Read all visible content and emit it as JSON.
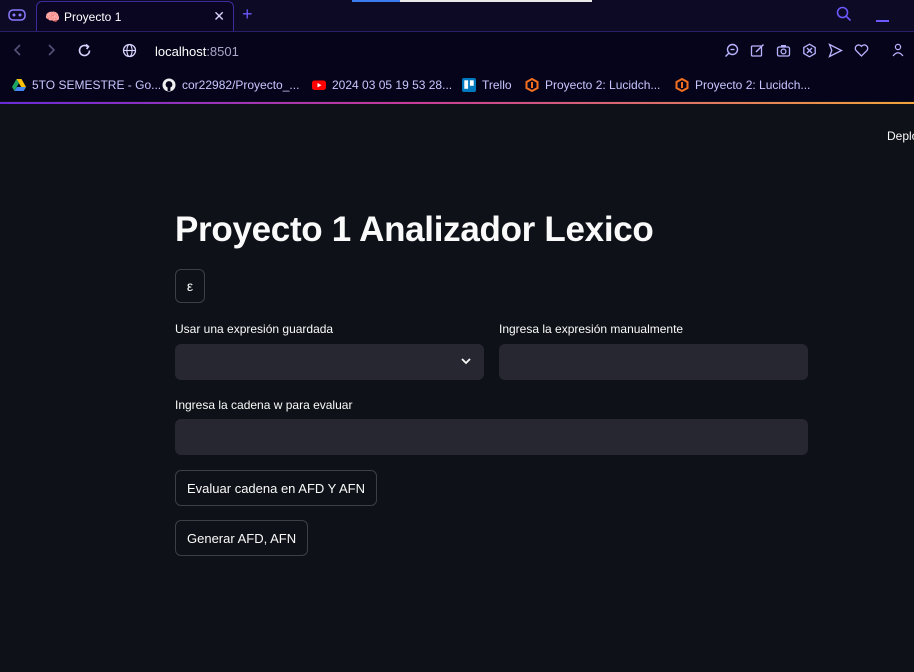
{
  "browser": {
    "tab_title": "Proyecto 1",
    "tab_favicon": "🧠",
    "new_tab_symbol": "+",
    "close_symbol": "✕",
    "url_host": "localhost",
    "url_port": ":8501",
    "accent_color": "#6b58ff",
    "icons": [
      "back-icon",
      "forward-icon",
      "reload-icon",
      "site-info-icon",
      "zoom-icon",
      "edit-icon",
      "camera-icon",
      "block-icon",
      "send-icon",
      "heart-icon",
      "profile-icon"
    ]
  },
  "bookmarks": [
    {
      "label": "5TO SEMESTRE - Go...",
      "icon": "google-drive-icon"
    },
    {
      "label": "cor22982/Proyecto_...",
      "icon": "github-icon"
    },
    {
      "label": "2024 03 05 19 53 28...",
      "icon": "youtube-icon"
    },
    {
      "label": "Trello",
      "icon": "trello-icon"
    },
    {
      "label": "Proyecto 2: Lucidch...",
      "icon": "lucidchart-icon"
    },
    {
      "label": "Proyecto 2: Lucidch...",
      "icon": "lucidchart-icon"
    }
  ],
  "app": {
    "deploy_label": "Deplo",
    "title": "Proyecto 1 Analizador Lexico",
    "epsilon_button": "ε",
    "saved_expr_label": "Usar una expresión guardada",
    "saved_expr_value": "",
    "manual_expr_label": "Ingresa la expresión manualmente",
    "manual_expr_value": "",
    "string_label": "Ingresa la cadena w para evaluar",
    "string_value": "",
    "evaluate_button": "Evaluar cadena en AFD Y AFN",
    "generate_button": "Generar AFD, AFN",
    "background_color": "#0e1117",
    "input_color": "#262730"
  }
}
